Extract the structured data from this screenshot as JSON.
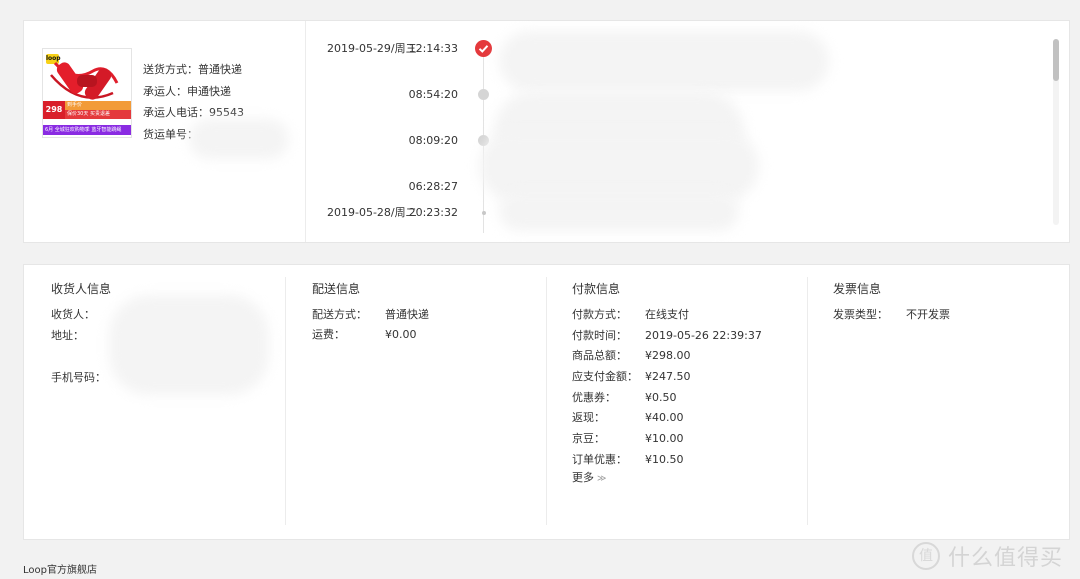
{
  "shipment": {
    "product_thumb": {
      "logo": "loop",
      "price": "298",
      "tag_top": "到手价",
      "tag_bottom": "保价30天 买贵退差",
      "promo_text": "6月 全城狂欢购物季 蓝牙智能跳绳"
    },
    "delivery_method": "送货方式：普通快递",
    "carrier": "承运人：申通快递",
    "carrier_phone": "承运人电话：95543",
    "tracking_number": "货运单号："
  },
  "timeline": [
    {
      "date": "2019-05-29/周三",
      "time": "12:14:33",
      "state": "active"
    },
    {
      "date": "",
      "time": "08:54:20",
      "state": "grey"
    },
    {
      "date": "",
      "time": "08:09:20",
      "state": "grey"
    },
    {
      "date": "",
      "time": "06:28:27",
      "state": "none"
    },
    {
      "date": "2019-05-28/周二",
      "time": "20:23:32",
      "state": "small"
    }
  ],
  "consignee": {
    "title": "收货人信息",
    "name_label": "收货人：",
    "address_label": "地址：",
    "phone_label": "手机号码："
  },
  "delivery": {
    "title": "配送信息",
    "method_label": "配送方式：",
    "method_value": "普通快递",
    "fee_label": "运费：",
    "fee_value": "¥0.00"
  },
  "payment": {
    "title": "付款信息",
    "rows": [
      {
        "label": "付款方式：",
        "value": "在线支付"
      },
      {
        "label": "付款时间：",
        "value": "2019-05-26 22:39:37"
      },
      {
        "label": "商品总额：",
        "value": "¥298.00"
      },
      {
        "label": "应支付金额：",
        "value": "¥247.50"
      },
      {
        "label": "优惠券：",
        "value": "¥0.50"
      },
      {
        "label": "返现：",
        "value": "¥40.00"
      },
      {
        "label": "京豆：",
        "value": "¥10.00"
      },
      {
        "label": "订单优惠：",
        "value": "¥10.50"
      }
    ],
    "more_label": "更多"
  },
  "invoice": {
    "title": "发票信息",
    "type_label": "发票类型：",
    "type_value": "不开发票"
  },
  "store_name": "Loop官方旗舰店",
  "watermark": {
    "icon": "值",
    "text": "什么值得买"
  }
}
